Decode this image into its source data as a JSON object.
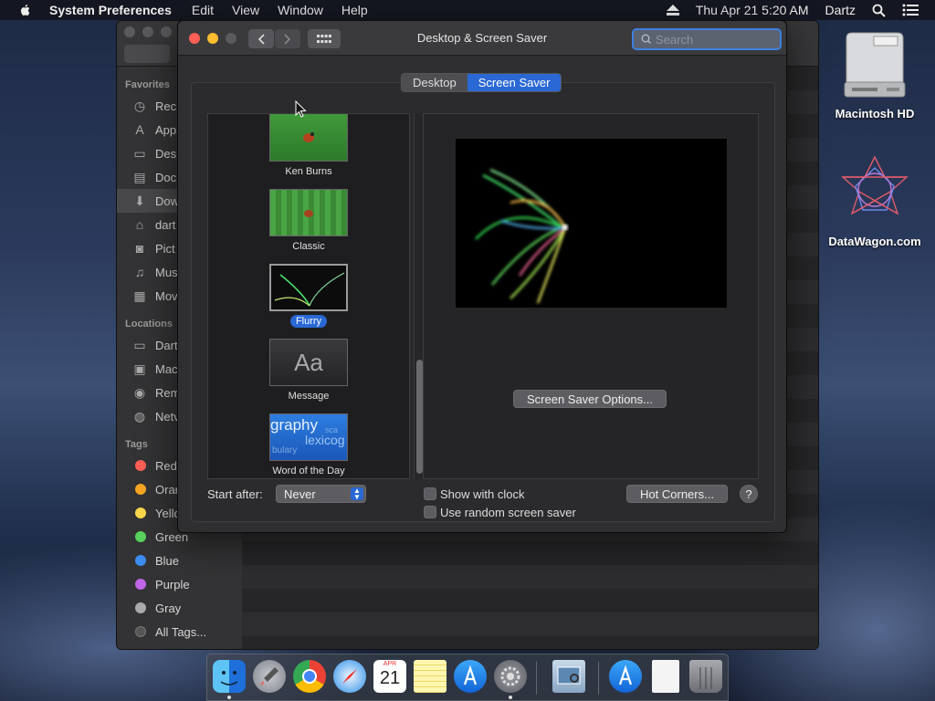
{
  "menubar": {
    "app": "System Preferences",
    "items": [
      "Edit",
      "View",
      "Window",
      "Help"
    ],
    "datetime": "Thu Apr 21  5:20 AM",
    "user": "Dartz"
  },
  "finder": {
    "favorites_header": "Favorites",
    "favorites": [
      {
        "label": "Rec",
        "icon": "recents-icon"
      },
      {
        "label": "App",
        "icon": "applications-icon"
      },
      {
        "label": "Des",
        "icon": "desktop-icon"
      },
      {
        "label": "Doc",
        "icon": "documents-icon"
      },
      {
        "label": "Dow",
        "icon": "downloads-icon"
      },
      {
        "label": "dart",
        "icon": "home-icon"
      },
      {
        "label": "Pict",
        "icon": "pictures-icon"
      },
      {
        "label": "Mus",
        "icon": "music-icon"
      },
      {
        "label": "Mov",
        "icon": "movies-icon"
      }
    ],
    "locations_header": "Locations",
    "locations": [
      {
        "label": "Dart",
        "icon": "computer-icon"
      },
      {
        "label": "Mac",
        "icon": "disk-icon"
      },
      {
        "label": "Rem",
        "icon": "remote-disc-icon"
      },
      {
        "label": "Netv",
        "icon": "network-icon"
      }
    ],
    "tags_header": "Tags",
    "tags": [
      {
        "label": "Red",
        "color": "#ff5f57"
      },
      {
        "label": "Oran",
        "color": "#f5a623"
      },
      {
        "label": "Yello",
        "color": "#f8d74a"
      },
      {
        "label": "Green",
        "color": "#58d25c"
      },
      {
        "label": "Blue",
        "color": "#3c8cf2"
      },
      {
        "label": "Purple",
        "color": "#c065e6"
      },
      {
        "label": "Gray",
        "color": "#a9a9ad"
      },
      {
        "label": "All Tags...",
        "color": "#555"
      }
    ]
  },
  "desktop": {
    "hd_label": "Macintosh HD",
    "datawagon_label": "DataWagon.com"
  },
  "window": {
    "title": "Desktop & Screen Saver",
    "search_placeholder": "Search",
    "tabs": {
      "desktop": "Desktop",
      "screen_saver": "Screen Saver"
    }
  },
  "savers": [
    {
      "label": "Ken Burns",
      "selected": false
    },
    {
      "label": "Classic",
      "selected": false
    },
    {
      "label": "Flurry",
      "selected": true
    },
    {
      "label": "Message",
      "selected": false,
      "thumb_text": "Aa"
    },
    {
      "label": "Word of the Day",
      "selected": false,
      "thumb_words": [
        "graphy",
        "lexicog",
        "bulary",
        "sca"
      ]
    }
  ],
  "options_button": "Screen Saver Options...",
  "start_after_label": "Start after:",
  "start_after_value": "Never",
  "show_clock": "Show with clock",
  "random_saver": "Use random screen saver",
  "hot_corners": "Hot Corners...",
  "help_glyph": "?",
  "dock_apps": [
    "finder",
    "launchpad",
    "chrome",
    "safari",
    "calendar",
    "notes",
    "app-store",
    "system-preferences",
    "preview",
    "app-store-folder",
    "document",
    "trash"
  ],
  "calendar_icon": {
    "month": "APR",
    "day": "21"
  }
}
